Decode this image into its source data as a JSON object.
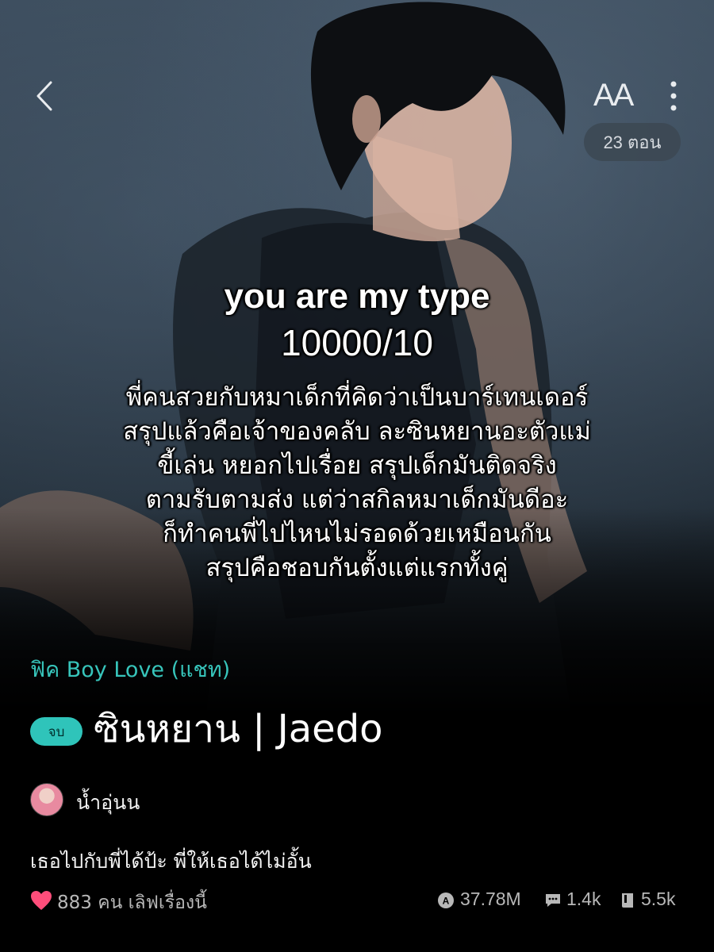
{
  "header": {
    "font_size_label": "AA",
    "episode_badge": "23 ตอน"
  },
  "cover": {
    "title": "you are my type",
    "score": "10000/10",
    "lines": [
      "พี่คนสวยกับหมาเด็กที่คิดว่าเป็นบาร์เทนเดอร์",
      "สรุปแล้วคือเจ้าของคลับ ละซินหยานอะตัวแม่",
      "ขี้เล่น หยอกไปเรื่อย สรุปเด็กมันติดจริง",
      "ตามรับตามส่ง แต่ว่าสกิลหมาเด็กมันดีอะ",
      "ก็ทำคนพี่ไปไหนไม่รอดด้วยเหมือนกัน",
      "สรุปคือชอบกันตั้งแต่แรกทั้งคู่"
    ]
  },
  "story": {
    "genre": "ฟิค Boy Love (แชท)",
    "status_badge": "จบ",
    "title": "ซินหยาน | Jaedo",
    "author": "น้ำอุ่นน",
    "tagline": "เธอไปกับพี่ได้ป้ะ พี่ให้เธอได้ไม่อั้น"
  },
  "stats": {
    "likes_text": "883 คน เลิฟเรื่องนี้",
    "views": "37.78M",
    "comments": "1.4k",
    "bookmarks": "5.5k"
  },
  "colors": {
    "accent": "#2fc4ba",
    "heart": "#ff4d7a"
  },
  "icons": {
    "back": "chevron-left-icon",
    "more": "more-vertical-icon",
    "heart": "heart-icon",
    "views": "eye-icon",
    "comments": "comment-icon",
    "bookmarks": "book-icon"
  }
}
